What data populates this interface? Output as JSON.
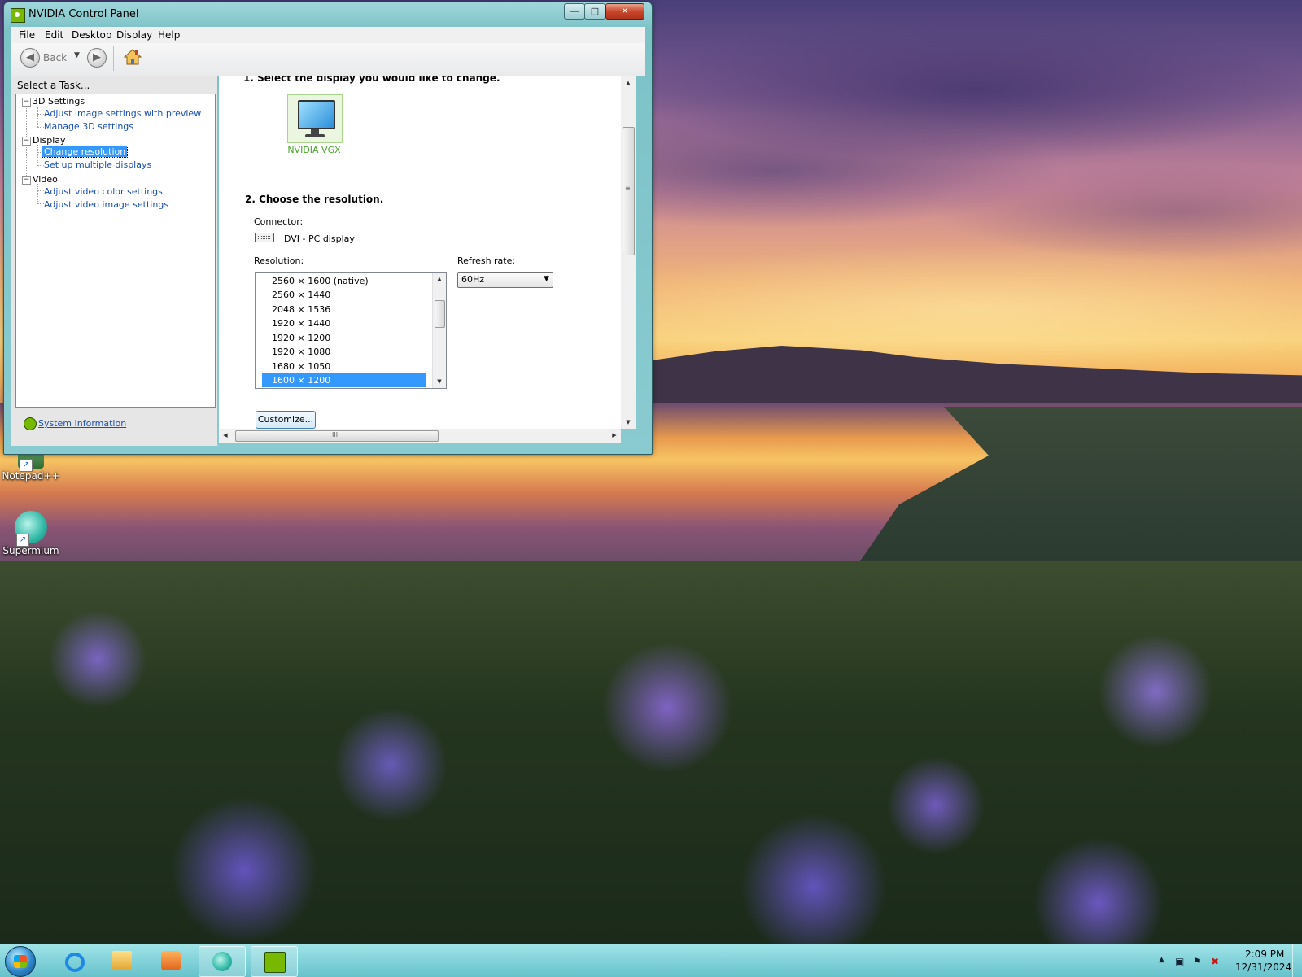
{
  "window": {
    "title": "NVIDIA Control Panel",
    "caption": {
      "minimize": "—",
      "maximize": "□",
      "close": "✕"
    }
  },
  "menubar": [
    "File",
    "Edit",
    "Desktop",
    "Display",
    "Help"
  ],
  "toolbar": {
    "back_label": "Back",
    "back_dropdown": "▼",
    "back_glyph": "◀",
    "forward_glyph": "▶"
  },
  "task_pane": {
    "title": "Select a Task...",
    "tree": {
      "group_3d": "3D Settings",
      "adjust_image": "Adjust image settings with preview",
      "manage_3d": "Manage 3D settings",
      "group_display": "Display",
      "change_resolution": "Change resolution",
      "multiple_displays": "Set up multiple displays",
      "group_video": "Video",
      "video_color": "Adjust video color settings",
      "video_image": "Adjust video image settings",
      "toggle": "−"
    },
    "system_info": "System Information"
  },
  "content": {
    "step1": "1. Select the display you would like to change.",
    "display_name": "NVIDIA VGX",
    "step2": "2. Choose the resolution.",
    "connector_label": "Connector:",
    "connector_value": "DVI - PC display",
    "resolution_label": "Resolution:",
    "resolutions": [
      "2560 × 1600 (native)",
      "2560 × 1440",
      "2048 × 1536",
      "1920 × 1440",
      "1920 × 1200",
      "1920 × 1080",
      "1680 × 1050",
      "1600 × 1200"
    ],
    "selected_resolution_index": 7,
    "refresh_label": "Refresh rate:",
    "refresh_value": "60Hz",
    "customize_button": "Customize..."
  },
  "scroll_glyphs": {
    "up": "▲",
    "down": "▼",
    "left": "◀",
    "right": "▶",
    "grip_v": "≡",
    "grip_h": "III"
  },
  "desktop_icons": [
    {
      "label": "Notepad++",
      "icon": "notepad-plus-plus-icon"
    },
    {
      "label": "Supermium",
      "icon": "supermium-icon"
    }
  ],
  "taskbar": {
    "pinned": [
      "internet-explorer-icon",
      "file-explorer-icon",
      "media-player-icon",
      "supermium-icon",
      "nvidia-control-panel-icon"
    ],
    "tray": {
      "chevron": "▲",
      "network": "▣",
      "flag": "⚑",
      "volume": "✖"
    },
    "clock_time": "2:09 PM",
    "clock_date": "12/31/2024"
  },
  "colors": {
    "nvidia_green": "#76b900",
    "selection_blue": "#3399ff",
    "link_blue": "#1a4fb3"
  }
}
